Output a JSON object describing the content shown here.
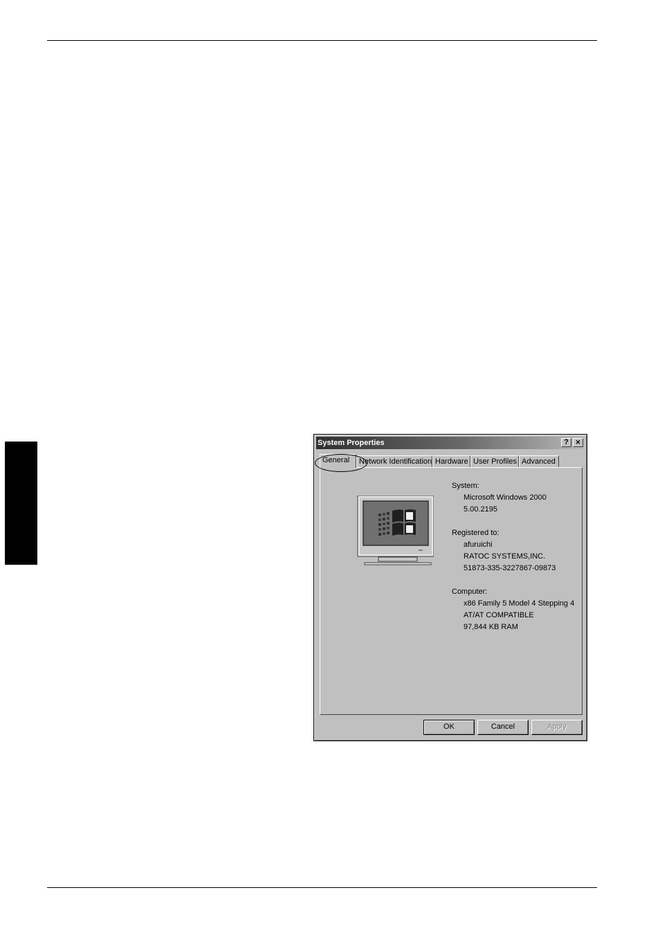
{
  "window": {
    "title": "System Properties",
    "help_glyph": "?",
    "close_glyph": "✕"
  },
  "tabs": [
    {
      "label": "General",
      "selected": true
    },
    {
      "label": "Network Identification",
      "selected": false
    },
    {
      "label": "Hardware",
      "selected": false
    },
    {
      "label": "User Profiles",
      "selected": false
    },
    {
      "label": "Advanced",
      "selected": false
    }
  ],
  "general": {
    "system_label": "System:",
    "system_lines": [
      "Microsoft Windows 2000",
      "5.00.2195"
    ],
    "registered_label": "Registered to:",
    "registered_lines": [
      "afuruichi",
      "RATOC SYSTEMS,INC.",
      "51873-335-3227867-09873"
    ],
    "computer_label": "Computer:",
    "computer_lines": [
      "x86 Family 5 Model 4 Stepping 4",
      "AT/AT COMPATIBLE",
      "97,844 KB RAM"
    ],
    "logo_icon": "windows-monitor-icon"
  },
  "buttons": {
    "ok": "OK",
    "cancel": "Cancel",
    "apply": "Apply"
  }
}
